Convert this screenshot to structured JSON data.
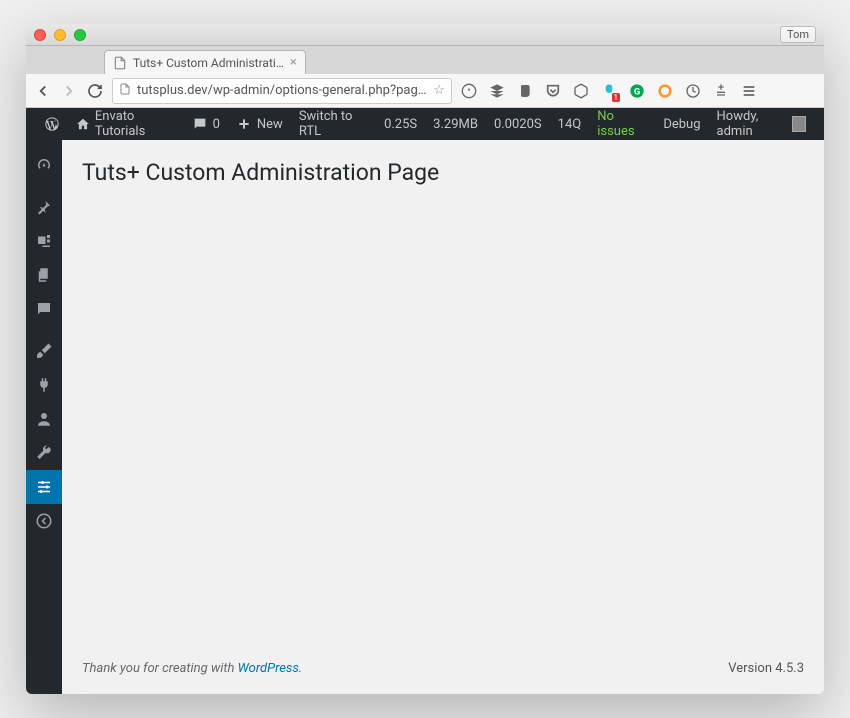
{
  "window": {
    "user_label": "Tom"
  },
  "browser": {
    "tab_title": "Tuts+ Custom Administrati…",
    "url": "tutsplus.dev/wp-admin/options-general.php?page=cu…",
    "ext_badge": "1"
  },
  "adminbar": {
    "site_title": "Envato Tutorials",
    "comments_count": "0",
    "new_label": "New",
    "rtl_label": "Switch to RTL",
    "time_label": "0.25S",
    "mem_label": "3.29MB",
    "db_label": "0.0020S",
    "queries_label": "14Q",
    "no_issues": "No issues",
    "debug_label": "Debug",
    "howdy_label": "Howdy, admin"
  },
  "page": {
    "heading": "Tuts+ Custom Administration Page"
  },
  "footer": {
    "thank_prefix": "Thank you for creating with ",
    "wp_link_text": "WordPress",
    "period": ".",
    "version": "Version 4.5.3"
  }
}
